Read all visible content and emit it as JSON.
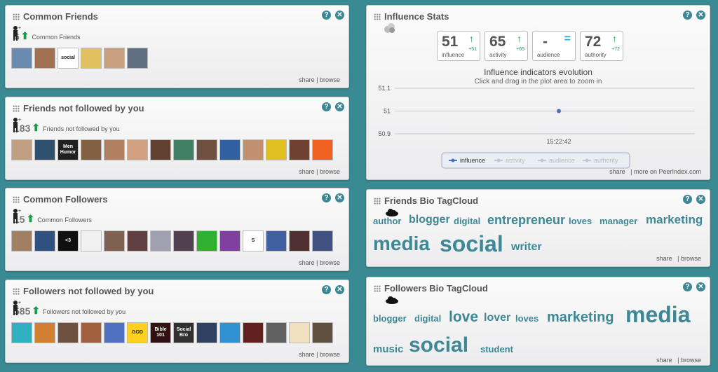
{
  "common_friends": {
    "title": "Common Friends",
    "count": "6",
    "label": "Common Friends",
    "avatars": [
      "#6a8ab0",
      "#a07050",
      "#ffffff",
      "#e0c060",
      "#c8a080",
      "#607080"
    ],
    "avatar_texts": [
      "",
      "",
      "social",
      "",
      "",
      ""
    ],
    "share": "share",
    "browse": "| browse"
  },
  "friends_not_followed": {
    "title": "Friends not followed by you",
    "count": "183",
    "label": "Friends not followed by you",
    "avatars": [
      "#c0a080",
      "#305070",
      "#202020",
      "#806040",
      "#b08060",
      "#d0a080",
      "#604030",
      "#408060",
      "#705040",
      "#3060a0",
      "#c09070",
      "#e0c020",
      "#704030",
      "#f06020"
    ],
    "avatar_texts": [
      "",
      "",
      "Men Humor",
      "",
      "",
      "",
      "",
      "",
      "",
      "",
      "",
      "",
      "",
      ""
    ],
    "share": "share",
    "browse": "| browse"
  },
  "common_followers": {
    "title": "Common Followers",
    "count": "15",
    "label": "Common Followers",
    "avatars": [
      "#a08060",
      "#305080",
      "#101010",
      "#f0f0f0",
      "#806050",
      "#604040",
      "#a0a0b0",
      "#504050",
      "#30b030",
      "#8040a0",
      "#ffffff",
      "#4060a0",
      "#503030",
      "#405080"
    ],
    "avatar_texts": [
      "",
      "",
      "<3",
      "",
      "",
      "",
      "",
      "",
      "",
      "",
      "S",
      "",
      "",
      ""
    ],
    "share": "share",
    "browse": "| browse"
  },
  "followers_not_followed": {
    "title": "Followers not followed by you",
    "count": "585",
    "label": "Followers not followed by you",
    "avatars": [
      "#30b0c0",
      "#d08030",
      "#705040",
      "#a06040",
      "#5070c0",
      "#ffd020",
      "#301010",
      "#303030",
      "#304060",
      "#3090d0",
      "#602020",
      "#606060",
      "#f0e0c0",
      "#605040"
    ],
    "avatar_texts": [
      "",
      "",
      "",
      "",
      "",
      "GOD",
      "Bible 101",
      "Social Bro",
      "",
      "",
      "",
      "",
      "",
      ""
    ],
    "share": "share",
    "browse": "| browse"
  },
  "influence_stats": {
    "title": "Influence Stats",
    "stats": [
      {
        "value": "51",
        "arrow": "↑",
        "delta": "+51",
        "name": "influence"
      },
      {
        "value": "65",
        "arrow": "↑",
        "delta": "+65",
        "name": "activity"
      },
      {
        "value": "-",
        "arrow": "=",
        "delta": "",
        "name": "audience"
      },
      {
        "value": "72",
        "arrow": "↑",
        "delta": "+72",
        "name": "authority"
      }
    ],
    "chart_title": "Influence indicators evolution",
    "chart_subtitle": "Click and drag in the plot area to zoom in",
    "share": "share",
    "more": "| more on PeerIndex.com"
  },
  "chart_data": {
    "type": "line",
    "title": "Influence indicators evolution",
    "x": [
      "15:22:42"
    ],
    "yticks": [
      "51.1",
      "51",
      "50.9"
    ],
    "ylim": [
      50.9,
      51.1
    ],
    "series": [
      {
        "name": "influence",
        "values": [
          51
        ]
      },
      {
        "name": "activity",
        "values": []
      },
      {
        "name": "audience",
        "values": []
      },
      {
        "name": "authority",
        "values": []
      }
    ]
  },
  "friends_bio": {
    "title": "Friends Bio TagCloud",
    "tags": [
      "author",
      "blogger",
      "digital",
      "entrepreneur",
      "loves",
      "manager",
      "marketing",
      "media",
      "social",
      "writer"
    ],
    "share": "share",
    "browse": "| browse"
  },
  "followers_bio": {
    "title": "Followers Bio TagCloud",
    "tags": [
      "blogger",
      "digital",
      "love",
      "lover",
      "loves",
      "marketing",
      "media",
      "music",
      "social",
      "student"
    ],
    "share": "share",
    "browse": "| browse"
  },
  "icons": {
    "help": "?",
    "close": "✕",
    "up": "⬆"
  },
  "colors": {
    "accent": "#3d8894",
    "green": "#1a9a4a",
    "background": "#3a8a94"
  }
}
